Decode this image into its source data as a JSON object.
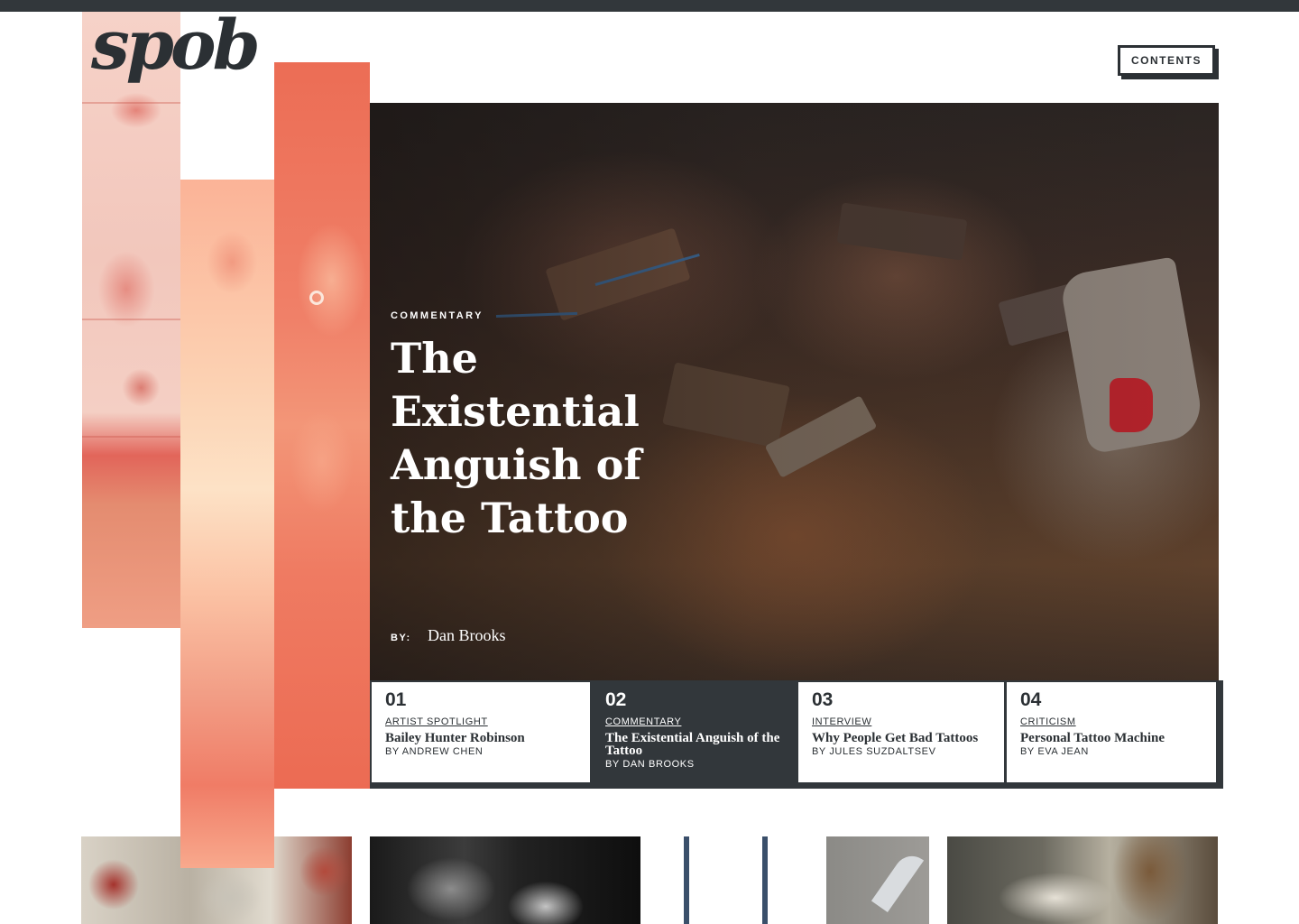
{
  "site": {
    "logo": "spob"
  },
  "header": {
    "contents_label": "CONTENTS"
  },
  "hero": {
    "category": "COMMENTARY",
    "title": "The Existential Anguish of the Tattoo",
    "by_label": "BY:",
    "author": "Dan Brooks"
  },
  "articles": [
    {
      "num": "01",
      "category": "ARTIST SPOTLIGHT",
      "title": "Bailey Hunter Robinson",
      "author": "BY ANDREW CHEN",
      "active": false
    },
    {
      "num": "02",
      "category": "COMMENTARY",
      "title": "The Existential Anguish of the Tattoo",
      "author": "BY DAN BROOKS",
      "active": true
    },
    {
      "num": "03",
      "category": "INTERVIEW",
      "title": "Why People Get Bad Tattoos",
      "author": "BY JULES SUZDALTSEV",
      "active": false
    },
    {
      "num": "04",
      "category": "CRITICISM",
      "title": "Personal Tattoo Machine",
      "author": "BY EVA JEAN",
      "active": false
    }
  ],
  "colors": {
    "ink": "#2b3034",
    "accent_coral": "#ec6d55",
    "accent_peach": "#fbb397",
    "accent_pink": "#f6d2c8"
  }
}
